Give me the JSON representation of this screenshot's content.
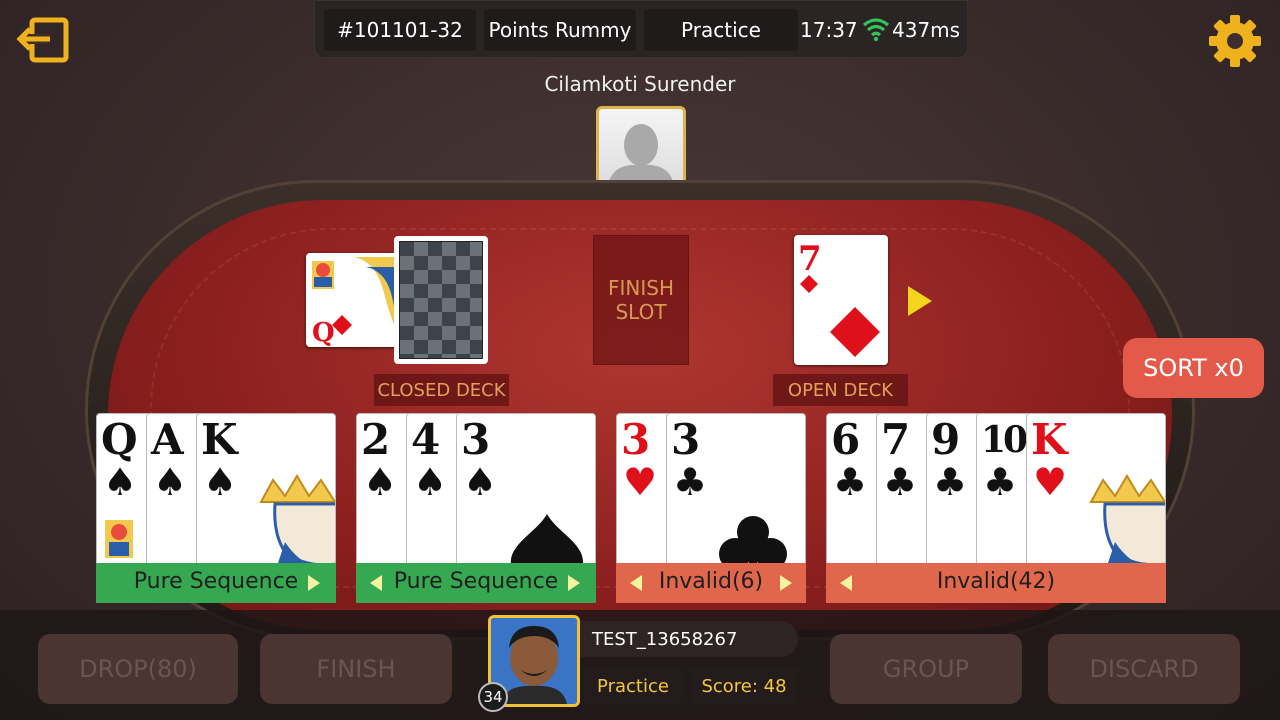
{
  "header": {
    "table_id": "#101101-32",
    "game_type": "Points Rummy",
    "mode": "Practice",
    "time": "17:37",
    "latency": "437ms"
  },
  "opponent": {
    "name": "Cilamkoti Surender"
  },
  "center": {
    "finish_slot_line1": "FINISH",
    "finish_slot_line2": "SLOT",
    "closed_deck_label": "CLOSED DECK",
    "open_deck_label": "OPEN DECK",
    "joker_card": {
      "rank": "Q",
      "suit": "diamonds",
      "color": "red"
    },
    "open_card": {
      "rank": "7",
      "suit": "diamonds",
      "color": "red"
    }
  },
  "sort": {
    "label": "SORT x0"
  },
  "groups": [
    {
      "label": "Pure Sequence",
      "status": "valid",
      "cards": [
        {
          "rank": "Q",
          "suit": "♠",
          "color": "black"
        },
        {
          "rank": "A",
          "suit": "♠",
          "color": "black"
        },
        {
          "rank": "K",
          "suit": "♠",
          "color": "black"
        }
      ]
    },
    {
      "label": "Pure Sequence",
      "status": "valid",
      "cards": [
        {
          "rank": "2",
          "suit": "♠",
          "color": "black"
        },
        {
          "rank": "4",
          "suit": "♠",
          "color": "black"
        },
        {
          "rank": "3",
          "suit": "♠",
          "color": "black"
        }
      ]
    },
    {
      "label": "Invalid(6)",
      "status": "invalid",
      "cards": [
        {
          "rank": "3",
          "suit": "♥",
          "color": "red"
        },
        {
          "rank": "3",
          "suit": "♣",
          "color": "black"
        }
      ]
    },
    {
      "label": "Invalid(42)",
      "status": "invalid",
      "cards": [
        {
          "rank": "6",
          "suit": "♣",
          "color": "black"
        },
        {
          "rank": "7",
          "suit": "♣",
          "color": "black"
        },
        {
          "rank": "9",
          "suit": "♣",
          "color": "black"
        },
        {
          "rank": "10",
          "suit": "♣",
          "color": "black"
        },
        {
          "rank": "K",
          "suit": "♥",
          "color": "red"
        }
      ]
    }
  ],
  "actions": {
    "drop": "DROP(80)",
    "finish": "FINISH",
    "group": "GROUP",
    "discard": "DISCARD"
  },
  "player": {
    "name": "TEST_13658267",
    "mode": "Practice",
    "score": "Score: 48",
    "level": "34"
  },
  "colors": {
    "felt": "#9b2623",
    "valid_group": "#37a852",
    "invalid_group": "#e0674c",
    "accent_gold": "#f3c83c",
    "sort_button": "#e35a4a"
  }
}
